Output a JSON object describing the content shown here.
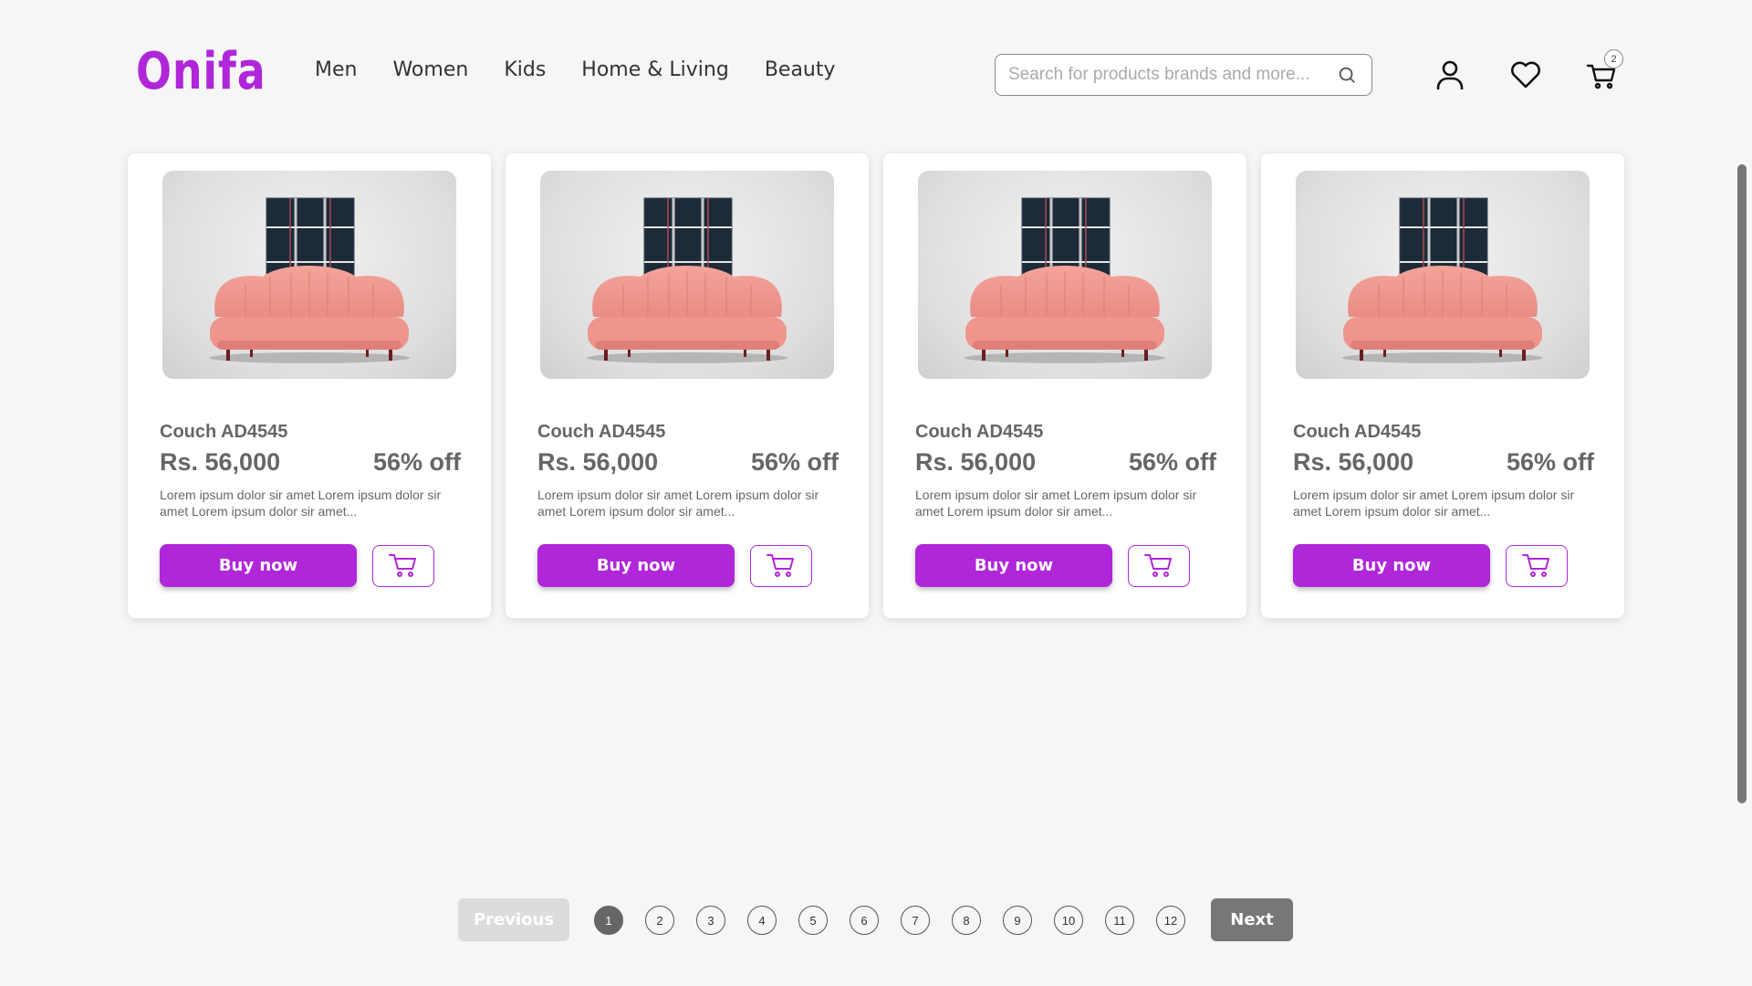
{
  "header": {
    "logo": "Onifa",
    "nav": [
      "Men",
      "Women",
      "Kids",
      "Home & Living",
      "Beauty"
    ],
    "search_placeholder": "Search for products brands and more...",
    "cart_count": "2"
  },
  "products": [
    {
      "name": "Couch AD4545",
      "price": "Rs. 56,000",
      "discount": "56% off",
      "description": "Lorem ipsum dolor sir amet Lorem ipsum dolor sir amet Lorem ipsum dolor sir amet...",
      "buy_label": "Buy now"
    },
    {
      "name": "Couch AD4545",
      "price": "Rs. 56,000",
      "discount": "56% off",
      "description": "Lorem ipsum dolor sir amet Lorem ipsum dolor sir amet Lorem ipsum dolor sir amet...",
      "buy_label": "Buy now"
    },
    {
      "name": "Couch AD4545",
      "price": "Rs. 56,000",
      "discount": "56% off",
      "description": "Lorem ipsum dolor sir amet Lorem ipsum dolor sir amet Lorem ipsum dolor sir amet...",
      "buy_label": "Buy now"
    },
    {
      "name": "Couch AD4545",
      "price": "Rs. 56,000",
      "discount": "56% off",
      "description": "Lorem ipsum dolor sir amet Lorem ipsum dolor sir amet Lorem ipsum dolor sir amet...",
      "buy_label": "Buy now"
    }
  ],
  "pagination": {
    "previous_label": "Previous",
    "next_label": "Next",
    "pages": [
      "1",
      "2",
      "3",
      "4",
      "5",
      "6",
      "7",
      "8",
      "9",
      "10",
      "11",
      "12"
    ],
    "current_page": "1"
  },
  "colors": {
    "accent": "#b026d9",
    "background": "#f6f6f6",
    "muted_text": "#666666",
    "disabled_button": "#dcdcdc",
    "next_button": "#777777"
  },
  "icons": {
    "search": "search-icon",
    "account": "user-icon",
    "wishlist": "heart-icon",
    "cart": "cart-icon"
  }
}
